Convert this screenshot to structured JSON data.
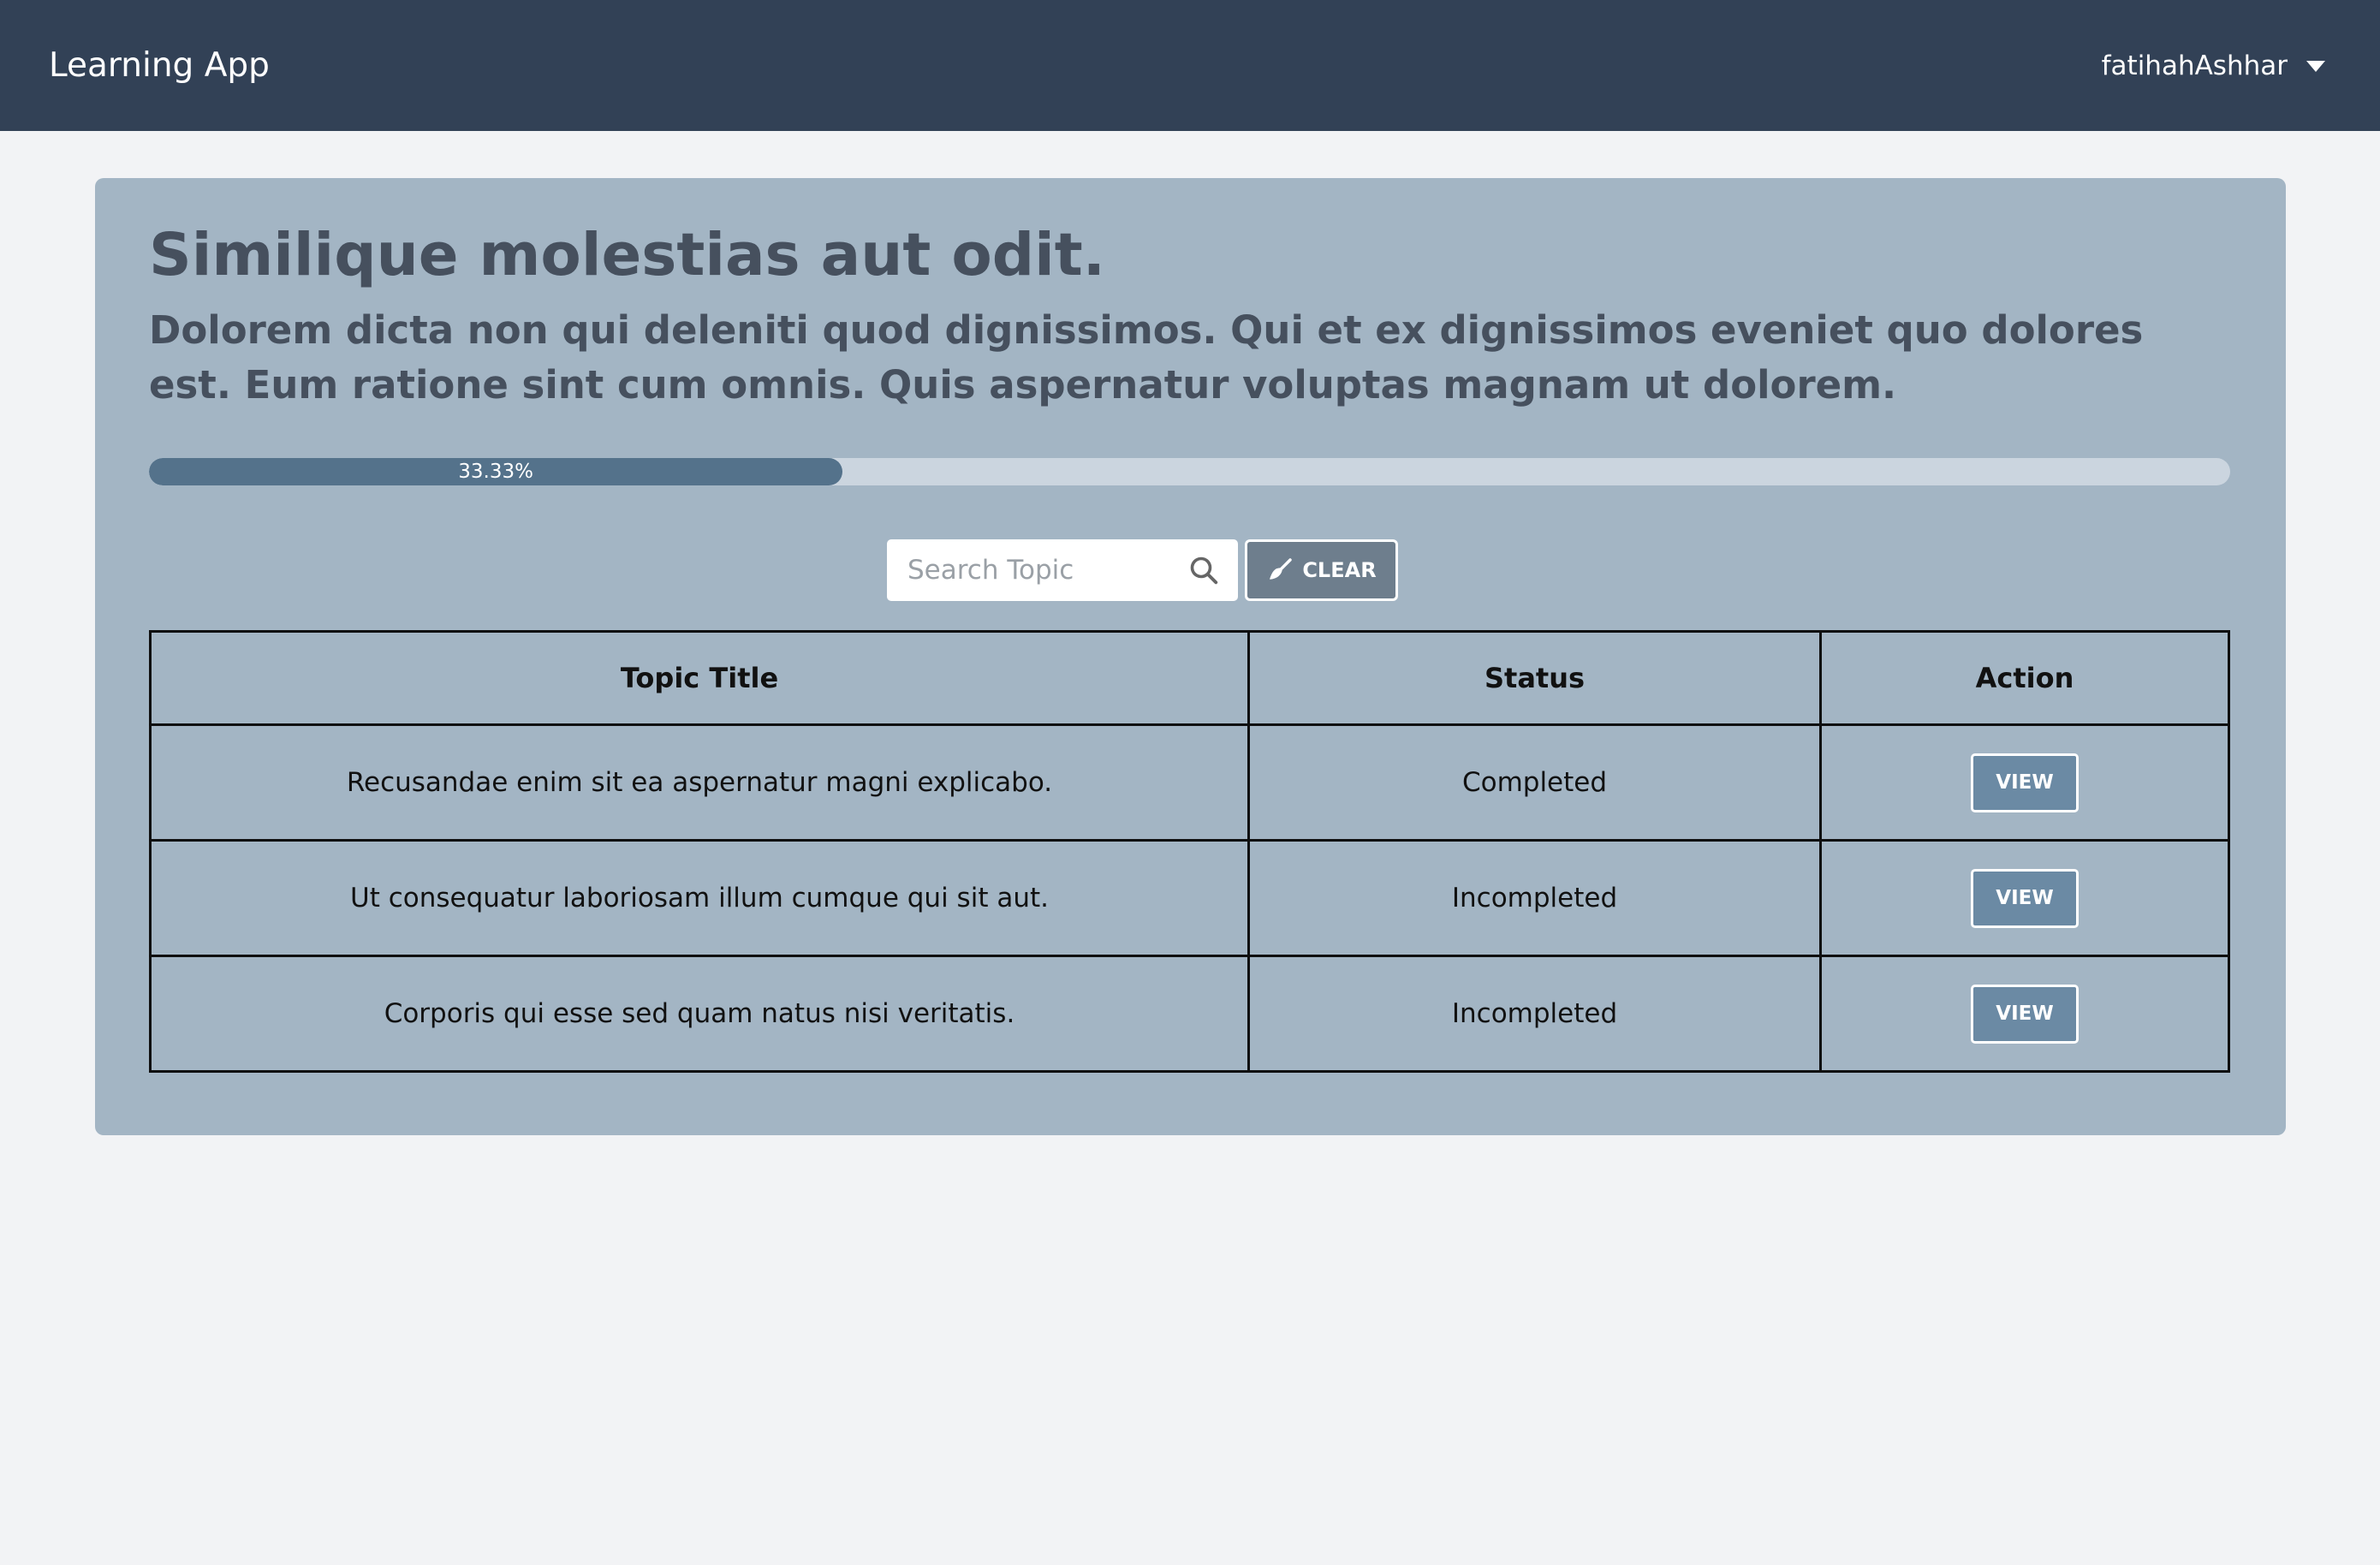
{
  "navbar": {
    "brand": "Learning App",
    "username": "fatihahAshhar"
  },
  "topic": {
    "title": "Similique molestias aut odit.",
    "description": "Dolorem dicta non qui deleniti quod dignissimos. Qui et ex dignissimos eveniet quo dolores est. Eum ratione sint cum omnis. Quis aspernatur voluptas magnam ut dolorem."
  },
  "progress": {
    "label": "33.33%",
    "percent": 33.33
  },
  "search": {
    "placeholder": "Search Topic",
    "value": "",
    "clear_label": "CLEAR"
  },
  "table": {
    "headers": [
      "Topic Title",
      "Status",
      "Action"
    ],
    "rows": [
      {
        "title": "Recusandae enim sit ea aspernatur magni explicabo.",
        "status": "Completed",
        "action": "VIEW"
      },
      {
        "title": "Ut consequatur laboriosam illum cumque qui sit aut.",
        "status": "Incompleted",
        "action": "VIEW"
      },
      {
        "title": "Corporis qui esse sed quam natus nisi veritatis.",
        "status": "Incompleted",
        "action": "VIEW"
      }
    ]
  },
  "colors": {
    "navbar": "#324156",
    "card": "#a3b5c4",
    "progress_fill": "#54728b",
    "view_button": "#6b8aa4"
  },
  "icons": {
    "search": "search-icon",
    "clear": "brush-icon",
    "user_menu": "chevron-down-icon"
  }
}
